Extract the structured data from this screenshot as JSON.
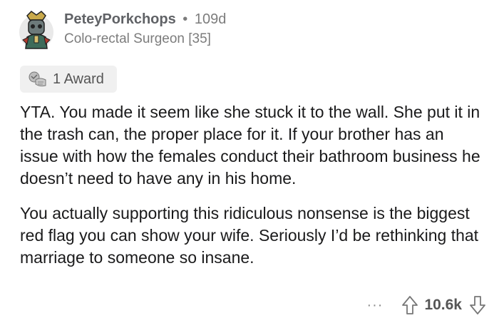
{
  "comment": {
    "username": "PeteyPorkchops",
    "separator": "•",
    "age": "109d",
    "flair": "Colo-rectal Surgeon [35]",
    "award_label": "1 Award",
    "paragraphs": [
      "YTA. You made it seem like she stuck it to the wall. She put it in the trash can, the proper place for it. If your brother has an issue with how the females conduct their bathroom business he doesn’t need to have any in his home.",
      "You actually supporting this ridiculous nonsense is the biggest red flag you can show your wife. Seriously I’d be rethinking that marriage to someone so insane."
    ],
    "more_label": "···",
    "score": "10.6k"
  },
  "icons": {
    "avatar": "avatar-icon",
    "award": "award-icon",
    "upvote": "upvote-arrow-icon",
    "downvote": "downvote-arrow-icon"
  }
}
